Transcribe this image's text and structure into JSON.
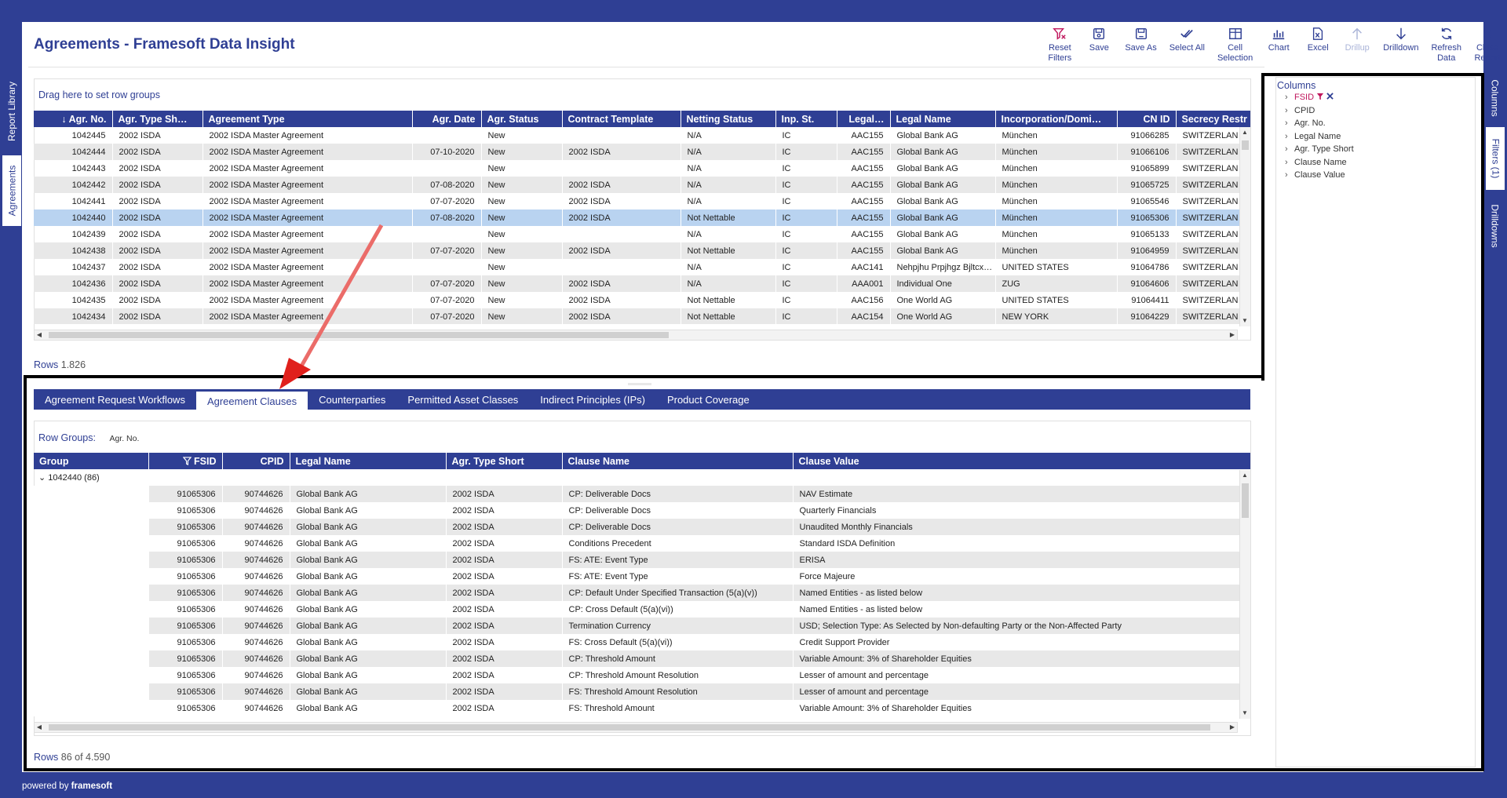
{
  "app": {
    "title": "Agreements - Framesoft Data Insight",
    "powered_prefix": "powered by",
    "powered_brand": "framesoft"
  },
  "left_tabs": [
    "Report Library",
    "Agreements"
  ],
  "right_tabs": [
    "Columns",
    "Filters (1)",
    "Drilldowns"
  ],
  "toolbar": [
    {
      "label": "Reset\nFilters",
      "icon": "reset-filters-icon"
    },
    {
      "label": "Save",
      "icon": "save-icon"
    },
    {
      "label": "Save As",
      "icon": "save-as-icon"
    },
    {
      "label": "Select All",
      "icon": "select-all-icon"
    },
    {
      "label": "Cell\nSelection",
      "icon": "cell-selection-icon"
    },
    {
      "label": "Chart",
      "icon": "chart-icon"
    },
    {
      "label": "Excel",
      "icon": "excel-icon"
    },
    {
      "label": "Drillup",
      "icon": "drillup-icon",
      "disabled": true
    },
    {
      "label": "Drilldown",
      "icon": "drilldown-icon"
    },
    {
      "label": "Refresh\nData",
      "icon": "refresh-icon"
    },
    {
      "label": "Close\nReport",
      "icon": "close-icon"
    }
  ],
  "top_grid": {
    "drag_hint": "Drag here to set row groups",
    "rows_label": "Rows",
    "rows_value": "1.826",
    "columns": [
      "Agr. No.",
      "Agr. Type Sh…",
      "Agreement Type",
      "Agr. Date",
      "Agr. Status",
      "Contract Template",
      "Netting Status",
      "Inp. St.",
      "Legal…",
      "Legal Name",
      "Incorporation/Domi…",
      "CN ID",
      "Secrecy Restr"
    ],
    "rows": [
      [
        "1042445",
        "2002 ISDA",
        "2002 ISDA Master Agreement",
        "",
        "New",
        "",
        "N/A",
        "IC",
        "AAC155",
        "Global Bank AG",
        "München",
        "91066285",
        "SWITZERLAN"
      ],
      [
        "1042444",
        "2002 ISDA",
        "2002 ISDA Master Agreement",
        "07-10-2020",
        "New",
        "2002 ISDA",
        "N/A",
        "IC",
        "AAC155",
        "Global Bank AG",
        "München",
        "91066106",
        "SWITZERLAN"
      ],
      [
        "1042443",
        "2002 ISDA",
        "2002 ISDA Master Agreement",
        "",
        "New",
        "",
        "N/A",
        "IC",
        "AAC155",
        "Global Bank AG",
        "München",
        "91065899",
        "SWITZERLAN"
      ],
      [
        "1042442",
        "2002 ISDA",
        "2002 ISDA Master Agreement",
        "07-08-2020",
        "New",
        "2002 ISDA",
        "N/A",
        "IC",
        "AAC155",
        "Global Bank AG",
        "München",
        "91065725",
        "SWITZERLAN"
      ],
      [
        "1042441",
        "2002 ISDA",
        "2002 ISDA Master Agreement",
        "07-07-2020",
        "New",
        "2002 ISDA",
        "N/A",
        "IC",
        "AAC155",
        "Global Bank AG",
        "München",
        "91065546",
        "SWITZERLAN"
      ],
      [
        "1042440",
        "2002 ISDA",
        "2002 ISDA Master Agreement",
        "07-08-2020",
        "New",
        "2002 ISDA",
        "Not Nettable",
        "IC",
        "AAC155",
        "Global Bank AG",
        "München",
        "91065306",
        "SWITZERLAN"
      ],
      [
        "1042439",
        "2002 ISDA",
        "2002 ISDA Master Agreement",
        "",
        "New",
        "",
        "N/A",
        "IC",
        "AAC155",
        "Global Bank AG",
        "München",
        "91065133",
        "SWITZERLAN"
      ],
      [
        "1042438",
        "2002 ISDA",
        "2002 ISDA Master Agreement",
        "07-07-2020",
        "New",
        "2002 ISDA",
        "Not Nettable",
        "IC",
        "AAC155",
        "Global Bank AG",
        "München",
        "91064959",
        "SWITZERLAN"
      ],
      [
        "1042437",
        "2002 ISDA",
        "2002 ISDA Master Agreement",
        "",
        "New",
        "",
        "N/A",
        "IC",
        "AAC141",
        "Nehpjhu Prpjhgz Bjltcx…",
        "UNITED STATES",
        "91064786",
        "SWITZERLAN"
      ],
      [
        "1042436",
        "2002 ISDA",
        "2002 ISDA Master Agreement",
        "07-07-2020",
        "New",
        "2002 ISDA",
        "N/A",
        "IC",
        "AAA001",
        "Individual One",
        "ZUG",
        "91064606",
        "SWITZERLAN"
      ],
      [
        "1042435",
        "2002 ISDA",
        "2002 ISDA Master Agreement",
        "07-07-2020",
        "New",
        "2002 ISDA",
        "Not Nettable",
        "IC",
        "AAC156",
        "One World AG",
        "UNITED STATES",
        "91064411",
        "SWITZERLAN"
      ],
      [
        "1042434",
        "2002 ISDA",
        "2002 ISDA Master Agreement",
        "07-07-2020",
        "New",
        "2002 ISDA",
        "Not Nettable",
        "IC",
        "AAC154",
        "One World AG",
        "NEW YORK",
        "91064229",
        "SWITZERLAN"
      ]
    ],
    "selected_row": 5
  },
  "bottom_tabs": [
    "Agreement Request Workflows",
    "Agreement Clauses",
    "Counterparties",
    "Permitted Asset Classes",
    "Indirect Principles (IPs)",
    "Product Coverage"
  ],
  "active_bottom_tab": 1,
  "bottom_grid": {
    "row_groups_label": "Row Groups:",
    "row_groups_value": "Agr. No.",
    "rows_label": "Rows",
    "rows_value": "86 of 4.590",
    "group_label": "1042440 (86)",
    "columns": [
      "Group",
      "FSID",
      "CPID",
      "Legal Name",
      "Agr. Type Short",
      "Clause Name",
      "Clause Value"
    ],
    "rows": [
      [
        "",
        "91065306",
        "90744626",
        "Global Bank AG",
        "2002 ISDA",
        "CP: Deliverable Docs",
        "NAV Estimate"
      ],
      [
        "",
        "91065306",
        "90744626",
        "Global Bank AG",
        "2002 ISDA",
        "CP: Deliverable Docs",
        "Quarterly Financials"
      ],
      [
        "",
        "91065306",
        "90744626",
        "Global Bank AG",
        "2002 ISDA",
        "CP: Deliverable Docs",
        "Unaudited Monthly Financials"
      ],
      [
        "",
        "91065306",
        "90744626",
        "Global Bank AG",
        "2002 ISDA",
        "Conditions Precedent",
        "Standard ISDA Definition"
      ],
      [
        "",
        "91065306",
        "90744626",
        "Global Bank AG",
        "2002 ISDA",
        "FS: ATE: Event Type",
        "ERISA"
      ],
      [
        "",
        "91065306",
        "90744626",
        "Global Bank AG",
        "2002 ISDA",
        "FS: ATE: Event Type",
        "Force Majeure"
      ],
      [
        "",
        "91065306",
        "90744626",
        "Global Bank AG",
        "2002 ISDA",
        "CP: Default Under Specified Transaction (5(a)(v))",
        "Named Entities - as listed below"
      ],
      [
        "",
        "91065306",
        "90744626",
        "Global Bank AG",
        "2002 ISDA",
        "CP: Cross Default (5(a)(vi))",
        "Named Entities - as listed below"
      ],
      [
        "",
        "91065306",
        "90744626",
        "Global Bank AG",
        "2002 ISDA",
        "Termination Currency",
        "USD; Selection Type: As Selected by Non-defaulting Party or the Non-Affected Party"
      ],
      [
        "",
        "91065306",
        "90744626",
        "Global Bank AG",
        "2002 ISDA",
        "FS: Cross Default (5(a)(vi))",
        "Credit Support Provider"
      ],
      [
        "",
        "91065306",
        "90744626",
        "Global Bank AG",
        "2002 ISDA",
        "CP: Threshold Amount",
        "Variable Amount: 3% of Shareholder Equities"
      ],
      [
        "",
        "91065306",
        "90744626",
        "Global Bank AG",
        "2002 ISDA",
        "CP: Threshold Amount Resolution",
        "Lesser of amount and percentage"
      ],
      [
        "",
        "91065306",
        "90744626",
        "Global Bank AG",
        "2002 ISDA",
        "FS: Threshold Amount Resolution",
        "Lesser of amount and percentage"
      ],
      [
        "",
        "91065306",
        "90744626",
        "Global Bank AG",
        "2002 ISDA",
        "FS: Threshold Amount",
        "Variable Amount: 3% of Shareholder Equities"
      ]
    ]
  },
  "columns_panel": {
    "title": "Columns",
    "items": [
      "FSID",
      "CPID",
      "Agr. No.",
      "Legal Name",
      "Agr. Type Short",
      "Clause Name",
      "Clause Value"
    ],
    "active_item": 0
  },
  "colors": {
    "brand": "#2f3f94",
    "selected_row": "#b9d3f0",
    "filter_active": "#c0175d",
    "annotation_arrow": "#e0201c"
  }
}
